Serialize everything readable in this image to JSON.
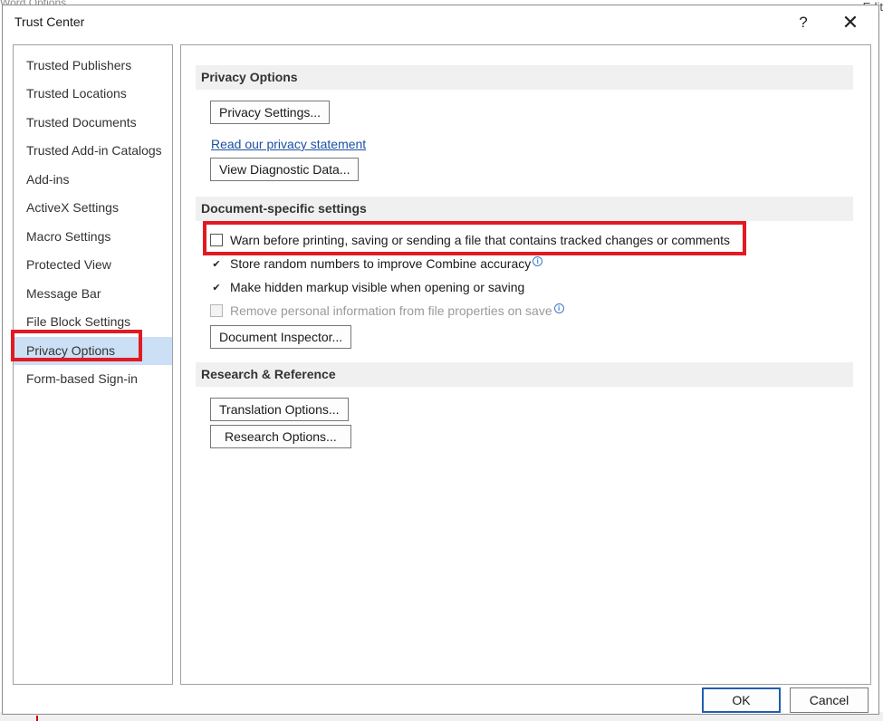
{
  "background": {
    "title": "Word Options",
    "right_text": "Edit"
  },
  "dialog": {
    "title": "Trust Center",
    "help_label": "?",
    "close_label": "✕"
  },
  "nav": {
    "items": [
      {
        "label": "Trusted Publishers"
      },
      {
        "label": "Trusted Locations"
      },
      {
        "label": "Trusted Documents"
      },
      {
        "label": "Trusted Add-in Catalogs"
      },
      {
        "label": "Add-ins"
      },
      {
        "label": "ActiveX Settings"
      },
      {
        "label": "Macro Settings"
      },
      {
        "label": "Protected View"
      },
      {
        "label": "Message Bar"
      },
      {
        "label": "File Block Settings"
      },
      {
        "label": "Privacy Options",
        "selected": true
      },
      {
        "label": "Form-based Sign-in"
      }
    ]
  },
  "privacy_section": {
    "header": "Privacy Options",
    "privacy_settings_button": "Privacy Settings...",
    "privacy_statement_link": "Read our privacy statement",
    "view_diagnostic_button": "View Diagnostic Data..."
  },
  "document_section": {
    "header": "Document-specific settings",
    "options": [
      {
        "label": "Warn before printing, saving or sending a file that contains tracked changes or comments",
        "checked": false,
        "disabled": false,
        "info": false
      },
      {
        "label": "Store random numbers to improve Combine accuracy",
        "checked": true,
        "disabled": false,
        "info": true
      },
      {
        "label": "Make hidden markup visible when opening or saving",
        "checked": true,
        "disabled": false,
        "info": false
      },
      {
        "label": "Remove personal information from file properties on save",
        "checked": false,
        "disabled": true,
        "info": true
      }
    ],
    "document_inspector_button": "Document Inspector..."
  },
  "research_section": {
    "header": "Research & Reference",
    "translation_button": "Translation Options...",
    "research_button": "Research Options..."
  },
  "footer": {
    "ok_label": "OK",
    "cancel_label": "Cancel"
  },
  "colors": {
    "highlight": "#e21a22",
    "selected_bg": "#cce0f5",
    "link": "#1c4fa3",
    "section_bg": "#f0f0f0"
  }
}
